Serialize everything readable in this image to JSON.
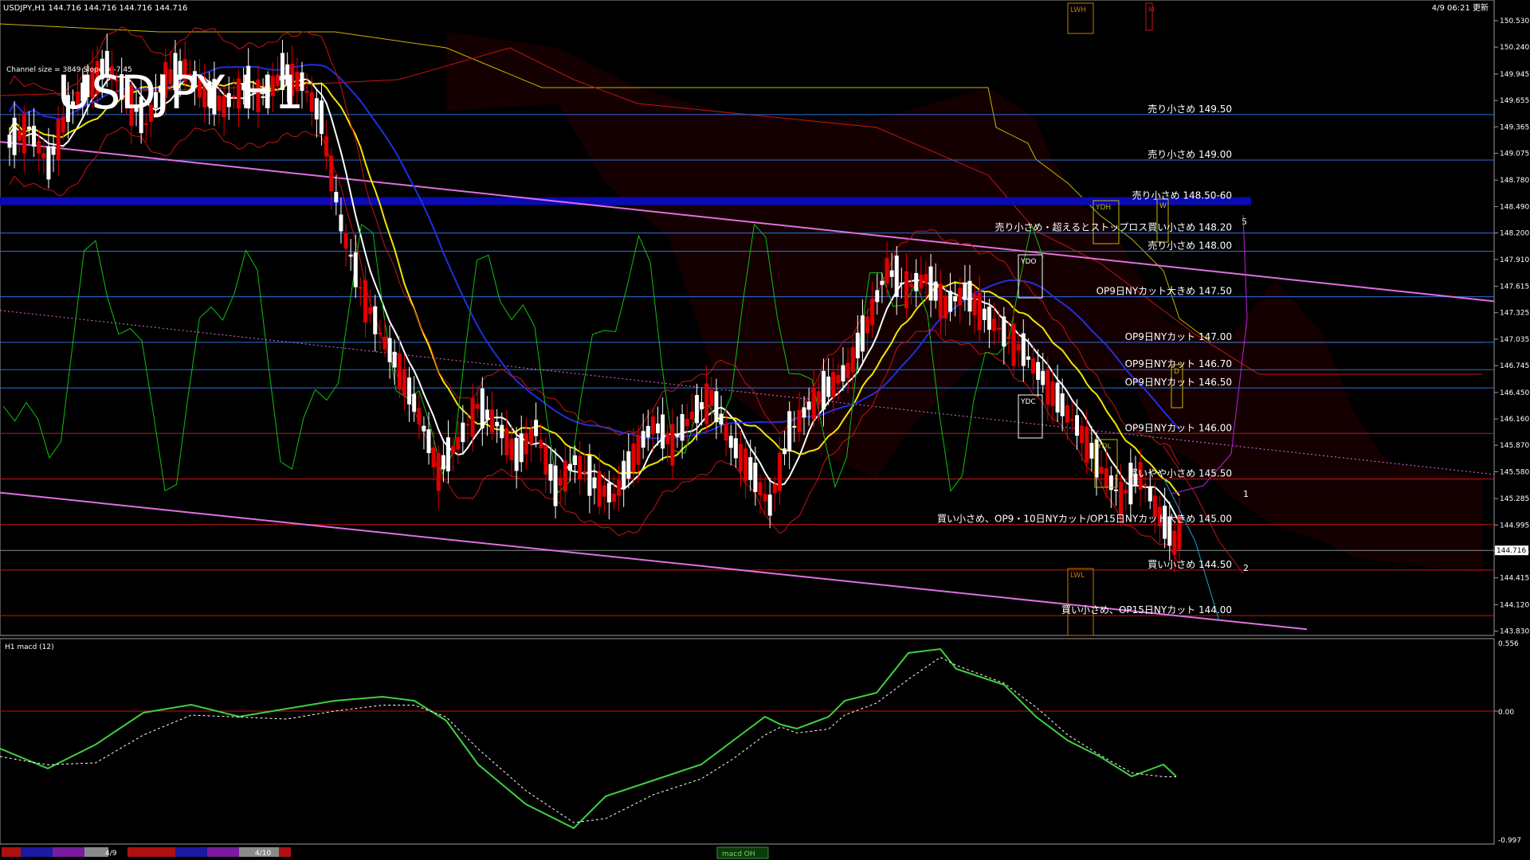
{
  "header": {
    "symbol_line": "USDJPY,H1 144.716 144.716 144.716 144.716",
    "datetime": "4/9 06:21 更新",
    "channel_info": "Channel size = 3849 Slope = -7.45"
  },
  "watermark": "USDJPY H1",
  "price_axis": {
    "ticks": [
      "150.530",
      "150.240",
      "149.945",
      "149.655",
      "149.365",
      "149.075",
      "148.780",
      "148.490",
      "148.200",
      "147.910",
      "147.615",
      "147.325",
      "147.035",
      "146.745",
      "146.450",
      "146.160",
      "145.870",
      "145.580",
      "145.285",
      "144.995",
      "144.705",
      "144.415",
      "144.120",
      "143.830"
    ],
    "current_price": "144.716"
  },
  "levels": [
    {
      "price": 149.5,
      "label": "売り小さめ 149.50",
      "color": "#2e6fd8"
    },
    {
      "price": 149.0,
      "label": "売り小さめ 149.00",
      "color": "#2e6fd8"
    },
    {
      "price": 148.55,
      "label": "売り小さめ 148.50-60",
      "color": "#1010c8"
    },
    {
      "price": 148.2,
      "label": "売り小さめ・超えるとストップロス買い小さめ 148.20",
      "color": "#2e6fd8"
    },
    {
      "price": 148.0,
      "label": "売り小さめ 148.00",
      "color": "#2e6fd8"
    },
    {
      "price": 147.5,
      "label": "OP9日NYカット大きめ 147.50",
      "color": "#2e6fd8"
    },
    {
      "price": 147.0,
      "label": "OP9日NYカット 147.00",
      "color": "#2e6fd8"
    },
    {
      "price": 146.7,
      "label": "OP9日NYカット 146.70",
      "color": "#2e6fd8"
    },
    {
      "price": 146.5,
      "label": "OP9日NYカット 146.50",
      "color": "#2e6fd8"
    },
    {
      "price": 146.0,
      "label": "OP9日NYカット 146.00",
      "color": "#c81414"
    },
    {
      "price": 145.5,
      "label": "買いやや小さめ 145.50",
      "color": "#c81414"
    },
    {
      "price": 145.0,
      "label": "買い小さめ、OP9・10日NYカット/OP15日NYカット大きめ 145.00",
      "color": "#c81414"
    },
    {
      "price": 144.5,
      "label": "買い小さめ 144.50",
      "color": "#c81414"
    },
    {
      "price": 144.0,
      "label": "買い小さめ、OP15日NYカット 144.00",
      "color": "#c81414"
    }
  ],
  "marker_labels": {
    "ydh": "YDH",
    "ydo": "YDO",
    "ydc": "YDC",
    "ydl": "YDL",
    "lwh": "LWH",
    "lwl": "LWL",
    "d": "D",
    "w": "W",
    "m": "M",
    "num1": "1",
    "num2": "2",
    "num5": "5"
  },
  "macd": {
    "label": "H1 macd (12)",
    "ticks": [
      "0.556",
      "0.00",
      "-0.997"
    ],
    "tab": "macd OH"
  },
  "time_axis": {
    "labels": [
      "4/9",
      "4/10"
    ]
  },
  "colors": {
    "bull": "#ffffff",
    "bear": "#e00000",
    "ma_white": "#ffffff",
    "ma_yellow": "#f2e600",
    "ma_blue": "#1f2fe0",
    "pink": "#e070e0",
    "green": "#10c010",
    "cloud_gold": "#c8b400"
  },
  "chart_data": {
    "type": "line",
    "title": "USDJPY H1",
    "series": [
      {
        "name": "USDJPY",
        "values": [
          149.2,
          149.35,
          148.95,
          149.55,
          149.8,
          150.05,
          149.7,
          149.4,
          149.9,
          150.0,
          149.75,
          149.6,
          149.8,
          149.7,
          149.95,
          149.85,
          149.45,
          148.3,
          147.6,
          147.1,
          146.7,
          146.2,
          145.6,
          145.9,
          146.3,
          146.1,
          145.75,
          146.05,
          145.4,
          145.7,
          145.45,
          145.3,
          145.75,
          146.1,
          145.9,
          146.2,
          146.4,
          145.9,
          145.6,
          145.2,
          146.0,
          146.3,
          146.5,
          146.7,
          147.2,
          147.8,
          147.6,
          147.7,
          147.4,
          147.55,
          147.3,
          147.1,
          146.9,
          146.6,
          146.3,
          146.0,
          145.6,
          145.3,
          145.55,
          145.1,
          144.72
        ]
      }
    ],
    "ylim": [
      143.8,
      150.6
    ],
    "xlabel": "",
    "ylabel": ""
  }
}
